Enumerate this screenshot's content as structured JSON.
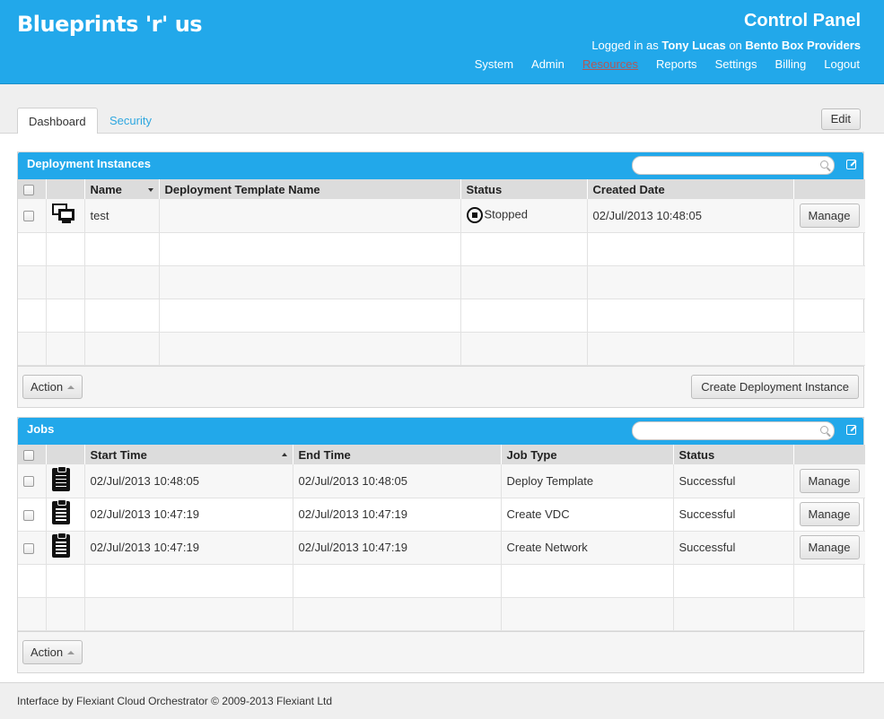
{
  "header": {
    "brand": "Blueprints 'r' us",
    "title": "Control Panel",
    "logged_in_prefix": "Logged in as",
    "user": "Tony Lucas",
    "on_text": "on",
    "org": "Bento Box Providers",
    "nav": [
      "System",
      "Admin",
      "Resources",
      "Reports",
      "Settings",
      "Billing",
      "Logout"
    ],
    "active_nav": "Resources"
  },
  "tabs": {
    "items": [
      "Dashboard",
      "Security"
    ],
    "active": "Dashboard",
    "edit_label": "Edit"
  },
  "deployments": {
    "title": "Deployment Instances",
    "search_placeholder": "",
    "columns": [
      "Name",
      "Deployment Template Name",
      "Status",
      "Created Date"
    ],
    "rows": [
      {
        "name": "test",
        "template": "",
        "status": "Stopped",
        "created": "02/Jul/2013 10:48:05",
        "action": "Manage"
      }
    ],
    "empty_rows": 4,
    "action_label": "Action",
    "create_label": "Create Deployment Instance"
  },
  "jobs": {
    "title": "Jobs",
    "search_placeholder": "",
    "columns": [
      "Start Time",
      "End Time",
      "Job Type",
      "Status"
    ],
    "rows": [
      {
        "start": "02/Jul/2013 10:48:05",
        "end": "02/Jul/2013 10:48:05",
        "type": "Deploy Template",
        "status": "Successful",
        "action": "Manage"
      },
      {
        "start": "02/Jul/2013 10:47:19",
        "end": "02/Jul/2013 10:47:19",
        "type": "Create VDC",
        "status": "Successful",
        "action": "Manage"
      },
      {
        "start": "02/Jul/2013 10:47:19",
        "end": "02/Jul/2013 10:47:19",
        "type": "Create Network",
        "status": "Successful",
        "action": "Manage"
      }
    ],
    "empty_rows": 2,
    "action_label": "Action"
  },
  "footer": {
    "text": "Interface by Flexiant Cloud Orchestrator © 2009-2013 Flexiant Ltd"
  },
  "colors": {
    "accent": "#22a8ea",
    "active_nav": "#b25757"
  }
}
